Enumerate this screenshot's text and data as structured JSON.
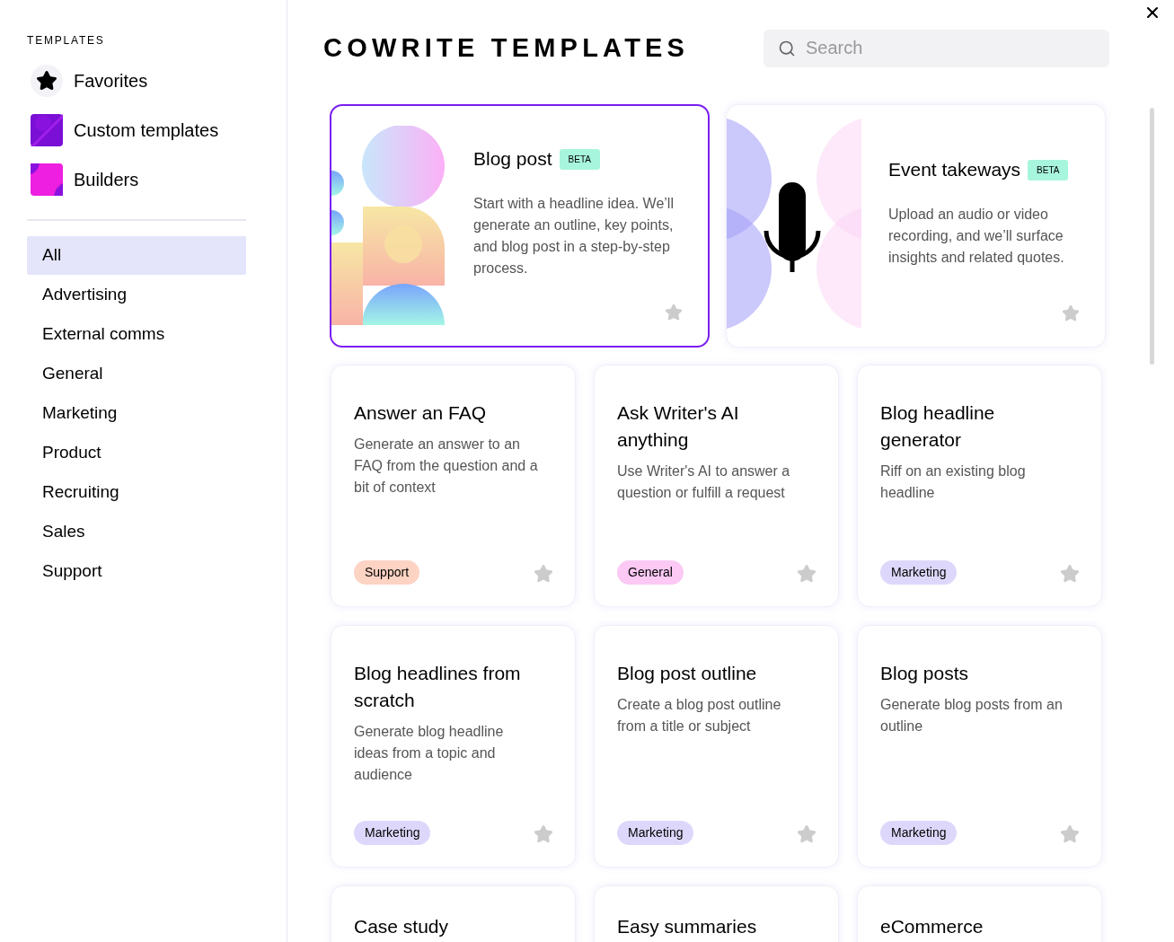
{
  "sidebar": {
    "heading": "TEMPLATES",
    "links": [
      {
        "kind": "favorites",
        "label": "Favorites"
      },
      {
        "kind": "custom",
        "label": "Custom templates"
      },
      {
        "kind": "builders",
        "label": "Builders"
      }
    ],
    "categories": [
      {
        "label": "All",
        "selected": true
      },
      {
        "label": "Advertising",
        "selected": false
      },
      {
        "label": "External comms",
        "selected": false
      },
      {
        "label": "General",
        "selected": false
      },
      {
        "label": "Marketing",
        "selected": false
      },
      {
        "label": "Product",
        "selected": false
      },
      {
        "label": "Recruiting",
        "selected": false
      },
      {
        "label": "Sales",
        "selected": false
      },
      {
        "label": "Support",
        "selected": false
      }
    ]
  },
  "header": {
    "title": "COWRITE TEMPLATES",
    "search": {
      "placeholder": "Search"
    }
  },
  "featured": [
    {
      "kind": "shapes",
      "title": "Blog post",
      "badge": "BETA",
      "description": "Start with a headline idea. We’ll generate an outline, key points, and blog post in a step-by-step process.",
      "selected": true
    },
    {
      "kind": "microphone",
      "title": "Event takeways",
      "badge": "BETA",
      "description": "Upload an audio or video recording, and we’ll surface insights and related quotes.",
      "selected": false
    }
  ],
  "templates": [
    {
      "title": "Answer an FAQ",
      "description": "Generate an answer to an FAQ from the question and a bit of context",
      "tag": "Support",
      "color": "#fdd3c4"
    },
    {
      "title": "Ask Writer's AI anything",
      "description": "Use Writer's AI to answer a question or fulfill a request",
      "tag": "General",
      "color": "#fbc9f4"
    },
    {
      "title": "Blog headline generator",
      "description": "Riff on an existing blog headline",
      "tag": "Marketing",
      "color": "#ddd8fb"
    },
    {
      "title": "Blog headlines from scratch",
      "description": "Generate blog headline ideas from a topic and audience",
      "tag": "Marketing",
      "color": "#ddd8fb"
    },
    {
      "title": "Blog post outline",
      "description": "Create a blog post outline from a title or subject",
      "tag": "Marketing",
      "color": "#ddd8fb"
    },
    {
      "title": "Blog posts",
      "description": "Generate blog posts from an outline",
      "tag": "Marketing",
      "color": "#ddd8fb"
    },
    {
      "title": "Case study"
    },
    {
      "title": "Easy summaries"
    },
    {
      "title": "eCommerce"
    }
  ]
}
